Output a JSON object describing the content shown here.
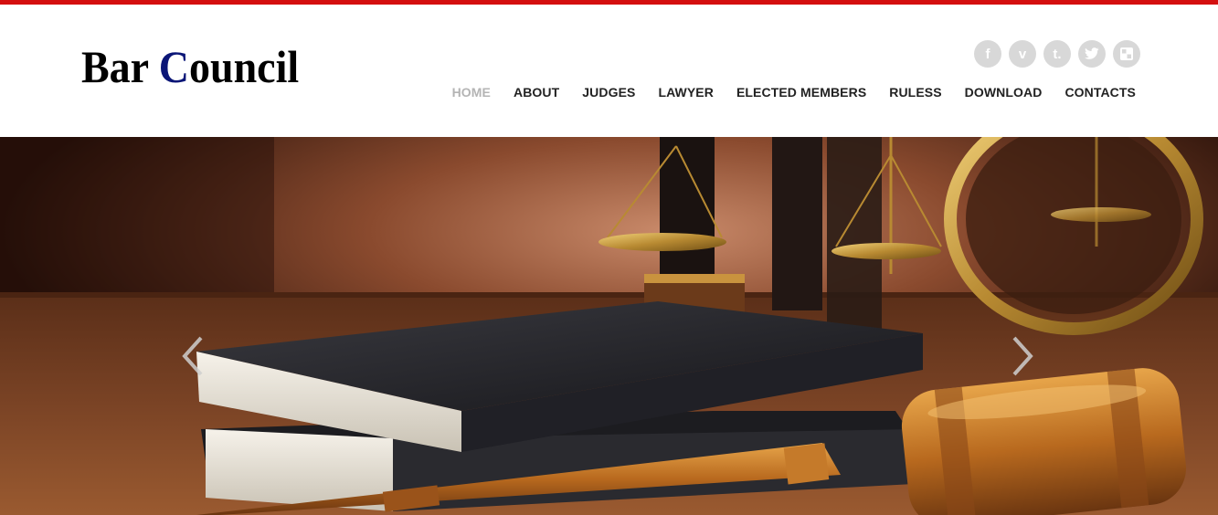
{
  "brand": {
    "logo_first": "Bar ",
    "logo_accent": "C",
    "logo_rest": "ouncil",
    "accent_color": "#0b1677",
    "top_bar_color": "#d40f0f"
  },
  "social": [
    {
      "icon": "facebook-icon",
      "glyph": "f"
    },
    {
      "icon": "vimeo-icon",
      "glyph": "v"
    },
    {
      "icon": "tumblr-icon",
      "glyph": "t."
    },
    {
      "icon": "twitter-icon",
      "glyph": "🐦"
    },
    {
      "icon": "flickr-icon",
      "glyph": "▣"
    }
  ],
  "nav": {
    "items": [
      {
        "label": "HOME",
        "active": true
      },
      {
        "label": "ABOUT"
      },
      {
        "label": "JUDGES"
      },
      {
        "label": "LAWYER"
      },
      {
        "label": "ELECTED MEMBERS"
      },
      {
        "label": "RULESS"
      },
      {
        "label": "DOWNLOAD"
      },
      {
        "label": "CONTACTS"
      }
    ]
  },
  "hero": {
    "image_subject": "law books, scales of justice and gavel",
    "prev_icon": "chevron-left-icon",
    "next_icon": "chevron-right-icon"
  }
}
